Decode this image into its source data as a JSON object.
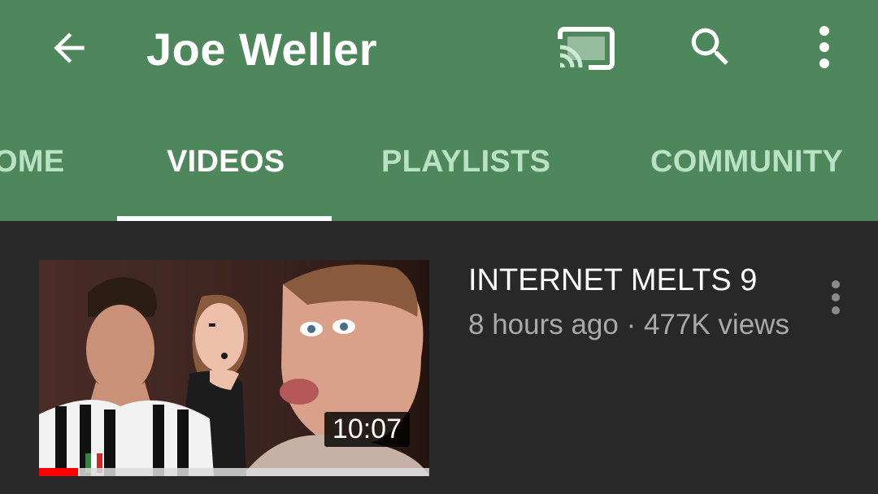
{
  "header": {
    "title": "Joe Weller",
    "background_color": "#4f875c",
    "icons": [
      "back-arrow-icon",
      "cast-icon",
      "search-icon",
      "more-vert-icon"
    ]
  },
  "tabs": [
    {
      "label": "HOME",
      "visible_text": "OME",
      "active": false
    },
    {
      "label": "VIDEOS",
      "visible_text": "VIDEOS",
      "active": true
    },
    {
      "label": "PLAYLISTS",
      "visible_text": "PLAYLISTS",
      "active": false
    },
    {
      "label": "COMMUNITY",
      "visible_text": "COMMUNITY",
      "active": false
    }
  ],
  "videos": [
    {
      "title": "INTERNET MELTS 9",
      "meta": "8 hours ago · 477K views",
      "duration": "10:07",
      "watch_progress": 0.1
    }
  ],
  "colors": {
    "tab_inactive": "#b9e2c2",
    "tab_active": "#ffffff",
    "body_background": "#282828",
    "progress_red": "#ff0000"
  }
}
